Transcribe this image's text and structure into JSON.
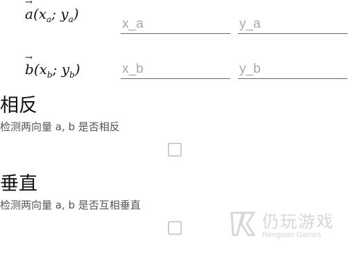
{
  "vector_a": {
    "label_name": "a",
    "label_x": "x",
    "label_x_sub": "a",
    "label_y": "y",
    "label_y_sub": "a",
    "x_placeholder": "x_a",
    "y_placeholder": "y_a"
  },
  "vector_b": {
    "label_name": "b",
    "label_x": "x",
    "label_x_sub": "b",
    "label_y": "y",
    "label_y_sub": "b",
    "x_placeholder": "x_b",
    "y_placeholder": "y_b"
  },
  "opposite": {
    "title": "相反",
    "description": "检测两向量 a, b 是否相反",
    "checked": false
  },
  "perpendicular": {
    "title": "垂直",
    "description": "检测两向量 a, b 是否互相垂直",
    "checked": false
  },
  "watermark": {
    "main": "仍玩游戏",
    "sub": "Rengwan Games"
  },
  "colors": {
    "underline": "#666666",
    "placeholder": "#a8a8a8",
    "checkbox_border": "#cfcfcf",
    "description": "#555555"
  }
}
